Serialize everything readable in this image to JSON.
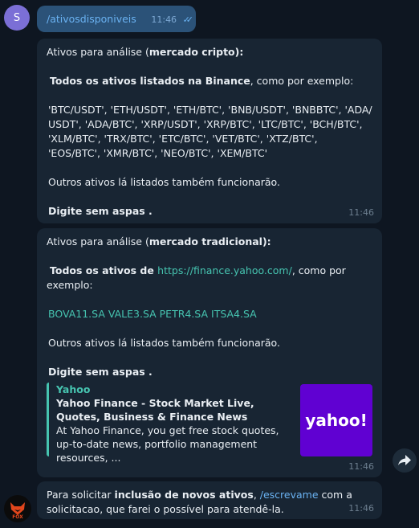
{
  "user": {
    "avatar_letter": "S"
  },
  "outgoing": {
    "text": "/ativosdisponiveis",
    "time": "11:46"
  },
  "msg1": {
    "intro_prefix": "Ativos para análise (",
    "intro_bold": "mercado cripto",
    "intro_suffix": "):",
    "all_bold": "Todos os ativos listados na Binance",
    "all_suffix": ", como por exemplo:",
    "examples": "'BTC/USDT', 'ETH/USDT', 'ETH/BTC', 'BNB/USDT', 'BNBBTC', 'ADA/ USDT', 'ADA/BTC', 'XRP/USDT', 'XRP/BTC', 'LTC/BTC', 'BCH/BTC', 'XLM/BTC', 'TRX/BTC', 'ETC/BTC', 'VET/BTC', 'XTZ/BTC', 'EOS/BTC', 'XMR/BTC', 'NEO/BTC', 'XEM/BTC'",
    "others": "Outros ativos lá listados também funcionarão.",
    "instruction": "Digite sem aspas .",
    "time": "11:46"
  },
  "msg2": {
    "intro_prefix": "Ativos para análise (",
    "intro_bold": "mercado tradicional",
    "intro_suffix": "):",
    "all_bold": "Todos os ativos de ",
    "url": "https://finance.yahoo.com/",
    "all_suffix": ", como por exemplo:",
    "examples": "BOVA11.SA VALE3.SA PETR4.SA ITSA4.SA",
    "others": "Outros ativos lá listados também funcionarão.",
    "instruction": "Digite sem aspas .",
    "preview": {
      "site": "Yahoo",
      "title": "Yahoo Finance - Stock Market Live, Quotes, Business & Finance News",
      "description": "At Yahoo Finance, you get free stock quotes, up-to-date news, portfolio management resources, ...",
      "logo_text": "yahoo!"
    },
    "time": "11:46"
  },
  "msg3": {
    "prefix": "Para solicitar ",
    "bold": "inclusão de novos ativos",
    "middle": ", ",
    "command": "/escrevame",
    "suffix": " com a solicitacao, que farei o possível para atendê-la.",
    "time": "11:46"
  },
  "bot": {
    "avatar_label": "FOX"
  },
  "icons": {
    "share": "share-arrow-icon",
    "checks": "double-check-icon"
  },
  "colors": {
    "background": "#0e1621",
    "bubble_in": "#182533",
    "bubble_out": "#2b5278",
    "accent": "#6ab2f2",
    "link": "#46c4b0",
    "yahoo": "#6001d2"
  }
}
